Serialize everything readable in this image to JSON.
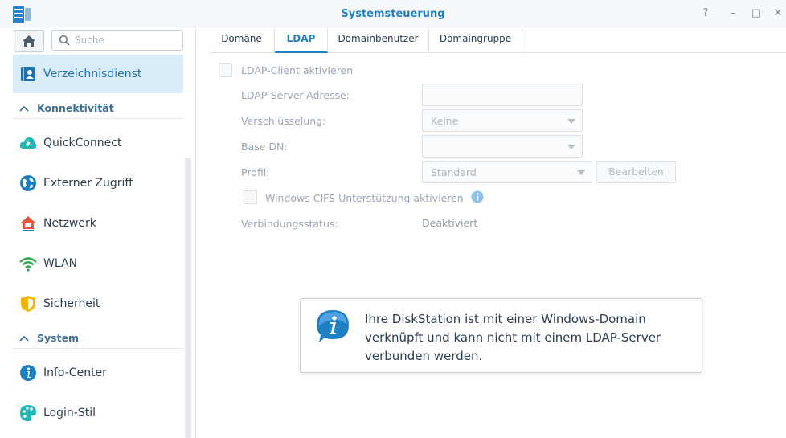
{
  "window": {
    "title": "Systemsteuerung"
  },
  "window_controls": {
    "help": "?",
    "minimize": "–",
    "maximize": "□",
    "close": "✕"
  },
  "sidebar": {
    "search_placeholder": "Suche",
    "active_item": {
      "label": "Verzeichnisdienst",
      "icon": "directory-icon"
    },
    "sections": [
      {
        "label": "Konnektivität",
        "items": [
          {
            "label": "QuickConnect",
            "icon": "quickconnect-icon"
          },
          {
            "label": "Externer Zugriff",
            "icon": "globe-icon"
          },
          {
            "label": "Netzwerk",
            "icon": "house-network-icon"
          },
          {
            "label": "WLAN",
            "icon": "wifi-icon"
          },
          {
            "label": "Sicherheit",
            "icon": "shield-icon"
          }
        ]
      },
      {
        "label": "System",
        "items": [
          {
            "label": "Info-Center",
            "icon": "info-icon"
          },
          {
            "label": "Login-Stil",
            "icon": "palette-icon"
          }
        ]
      }
    ]
  },
  "tabs": [
    {
      "label": "Domäne"
    },
    {
      "label": "LDAP",
      "active": true
    },
    {
      "label": "Domainbenutzer"
    },
    {
      "label": "Domaingruppe"
    }
  ],
  "form": {
    "enable_ldap_label": "LDAP-Client aktivieren",
    "server_address_label": "LDAP-Server-Adresse:",
    "server_address_value": "",
    "encryption_label": "Verschlüsselung:",
    "encryption_value": "Keine",
    "base_dn_label": "Base DN:",
    "base_dn_value": "",
    "profile_label": "Profil:",
    "profile_value": "Standard",
    "edit_button": "Bearbeiten",
    "cifs_label": "Windows CIFS Unterstützung aktivieren",
    "status_label": "Verbindungsstatus:",
    "status_value": "Deaktiviert"
  },
  "notice": {
    "message": "Ihre DiskStation ist mit einer Windows-Domain verknüpft und kann nicht mit einem LDAP-Server verbunden werden."
  },
  "colors": {
    "accent": "#1f7fc3",
    "active_bg": "#d9ecfa",
    "section_text": "#3f6f95"
  }
}
